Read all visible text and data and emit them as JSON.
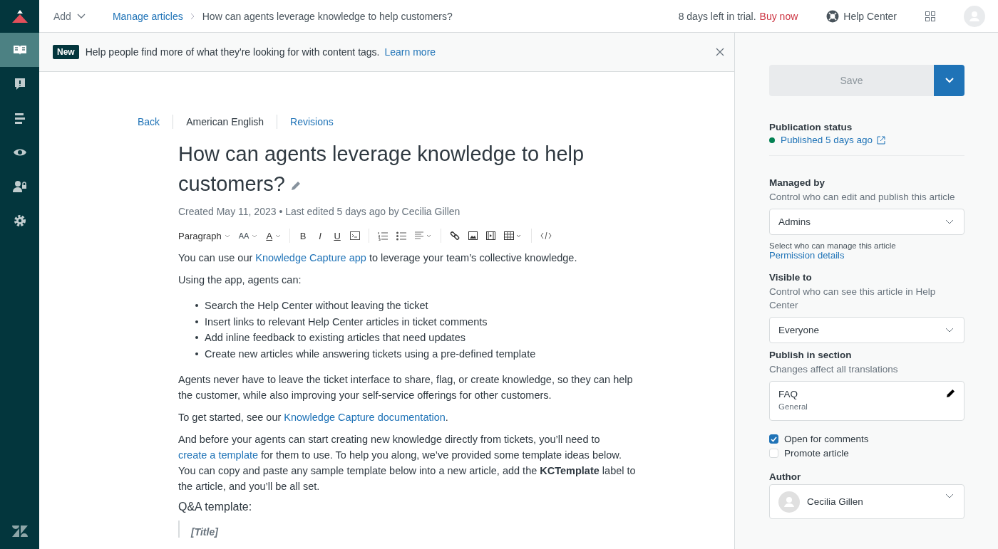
{
  "sidebar": {
    "items": [
      {
        "selected": true
      },
      {
        "selected": false
      },
      {
        "selected": false
      },
      {
        "selected": false
      },
      {
        "selected": false
      },
      {
        "selected": false
      }
    ]
  },
  "topbar": {
    "add": "Add",
    "breadcrumb": [
      "Manage articles",
      "How can agents leverage knowledge to help customers?"
    ],
    "trial": "8 days left in trial.",
    "buy": "Buy now",
    "help_center": "Help Center"
  },
  "banner": {
    "badge": "New",
    "text": "Help people find more of what they're looking for with content tags.",
    "link": "Learn more"
  },
  "article_tabs": [
    {
      "label": "Back",
      "kind": "link"
    },
    {
      "label": "American English",
      "kind": "text"
    },
    {
      "label": "Revisions",
      "kind": "link"
    }
  ],
  "title": "How can agents leverage knowledge to help customers?",
  "meta": "Created May 11, 2023 • Last edited 5 days ago by Cecilia Gillen",
  "toolbar": {
    "format": "Paragraph",
    "font_size": "AA",
    "font_color": "A",
    "styles": [
      "B",
      "I",
      "U"
    ]
  },
  "body": [
    {
      "kind": "paragraph",
      "parts": [
        {
          "text": "You can use our ",
          "link": false
        },
        {
          "text": "Knowledge Capture app",
          "link": true
        },
        {
          "text": " to leverage your team’s collective knowledge.",
          "link": false
        }
      ]
    },
    {
      "kind": "paragraph",
      "parts": [
        {
          "text": "Using the app, agents can:",
          "link": false
        }
      ]
    },
    {
      "kind": "list",
      "items": [
        "Search the Help Center without leaving the ticket",
        "Insert links to relevant Help Center articles in ticket comments",
        "Add inline feedback to existing articles that need updates",
        "Create new articles while answering tickets using a pre-defined template"
      ]
    },
    {
      "kind": "paragraph",
      "parts": [
        {
          "text": "Agents never have to leave the ticket interface to share, flag, or create knowledge, so they can help the customer, while also improving your self-service offerings for other customers.",
          "link": false
        }
      ]
    },
    {
      "kind": "paragraph",
      "parts": [
        {
          "text": "To get started, see our ",
          "link": false
        },
        {
          "text": "Knowledge Capture documentation",
          "link": true
        },
        {
          "text": ".",
          "link": false
        }
      ]
    },
    {
      "kind": "paragraph",
      "parts": [
        {
          "text": "And before your agents can start creating new knowledge directly from tickets, you’ll need to ",
          "link": false
        },
        {
          "text": "create a template",
          "link": true
        },
        {
          "text": " for them to use. To help you along, we’ve provided some template ideas below. You can copy and paste any sample template below into a new article, add the **KCTemplate** label to the article, and you’ll be all set.",
          "link": false
        }
      ]
    },
    {
      "kind": "heading",
      "text": "Q&A template:"
    },
    {
      "kind": "quote",
      "text": "[Title]"
    }
  ],
  "panel": {
    "save": "Save",
    "publication_label": "Publication status",
    "publication_status": "Published 5 days ago",
    "managed_label": "Managed by",
    "managed_hint": "Control who can edit and publish this article",
    "managed_value": "Admins",
    "managed_help": "Select who can manage this article",
    "permission_link": "Permission details",
    "visible_label": "Visible to",
    "visible_hint": "Control who can see this article in Help Center",
    "visible_value": "Everyone",
    "section_label": "Publish in section",
    "section_hint": "Changes affect all translations",
    "section_name": "FAQ",
    "section_category": "General",
    "options": [
      {
        "label": "Open for comments",
        "checked": true
      },
      {
        "label": "Promote article",
        "checked": false
      }
    ],
    "author_label": "Author",
    "author": "Cecilia Gillen"
  }
}
